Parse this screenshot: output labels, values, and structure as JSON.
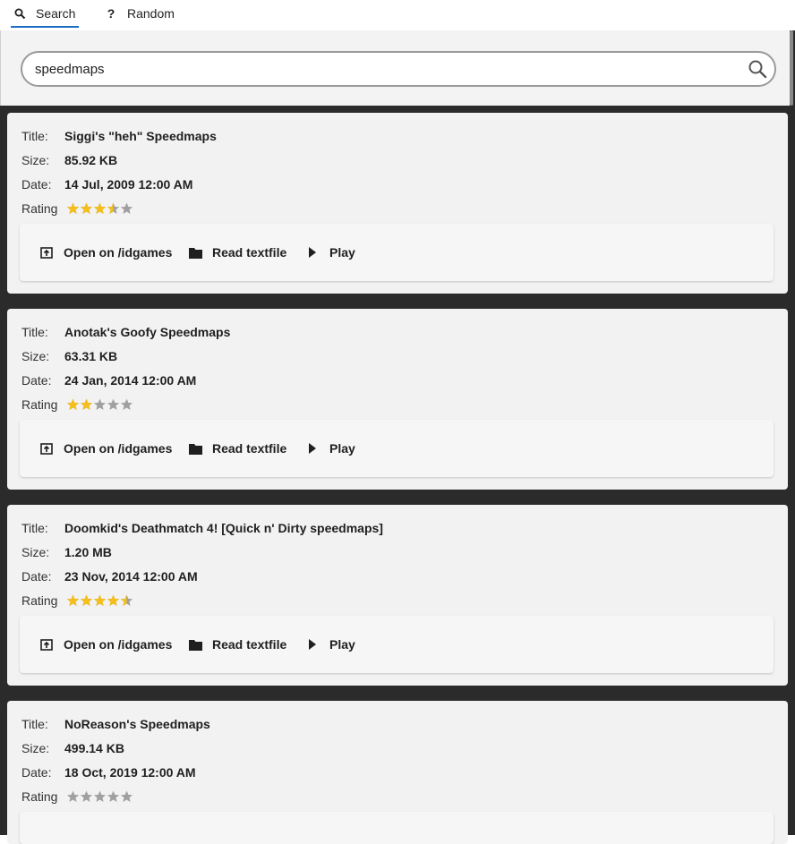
{
  "tabs": [
    {
      "label": "Search",
      "icon": "search-icon"
    },
    {
      "label": "Random",
      "icon": "question-icon"
    }
  ],
  "search": {
    "value": "speedmaps"
  },
  "labels": {
    "title": "Title:",
    "size": "Size:",
    "date": "Date:",
    "rating": "Rating"
  },
  "actions": {
    "open": "Open on /idgames",
    "read": "Read textfile",
    "play": "Play"
  },
  "colors": {
    "accent": "#1f6fc3",
    "star_filled": "#f4bf1a",
    "star_empty": "#a0a0a0",
    "background": "#2b2b2b"
  },
  "results": [
    {
      "title": "Siggi's \"heh\" Speedmaps",
      "size": "85.92 KB",
      "date": "14 Jul, 2009 12:00 AM",
      "rating": 3.5
    },
    {
      "title": "Anotak's Goofy Speedmaps",
      "size": "63.31 KB",
      "date": "24 Jan, 2014 12:00 AM",
      "rating": 2
    },
    {
      "title": "Doomkid's Deathmatch 4! [Quick n' Dirty speedmaps]",
      "size": "1.20 MB",
      "date": "23 Nov, 2014 12:00 AM",
      "rating": 4.5
    },
    {
      "title": "NoReason's Speedmaps",
      "size": "499.14 KB",
      "date": "18 Oct, 2019 12:00 AM",
      "rating": 0
    }
  ]
}
